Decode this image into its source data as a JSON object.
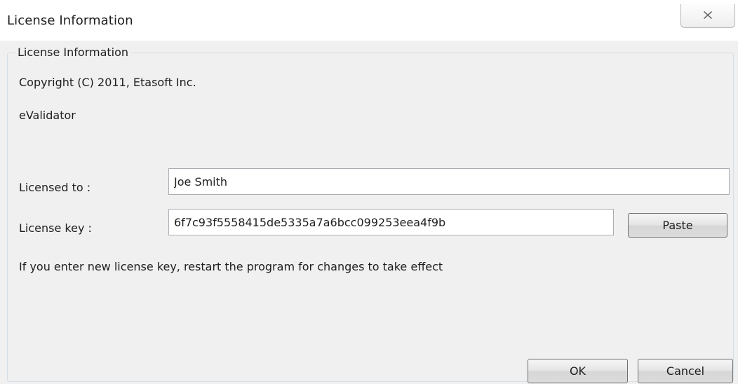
{
  "window": {
    "title": "License Information",
    "close_icon": "close-icon"
  },
  "group": {
    "legend": "License Information",
    "copyright": "Copyright (C) 2011, Etasoft Inc.",
    "product": "eValidator"
  },
  "form": {
    "licensed_to_label": "Licensed to :",
    "licensed_to_value": "Joe Smith",
    "license_key_label": "License key :",
    "license_key_value": "6f7c93f5558415de5335a7a6bcc099253eea4f9b",
    "paste_label": "Paste",
    "note": "If you enter new license key, restart the program for changes to take effect"
  },
  "buttons": {
    "ok_label": "OK",
    "cancel_label": "Cancel"
  }
}
